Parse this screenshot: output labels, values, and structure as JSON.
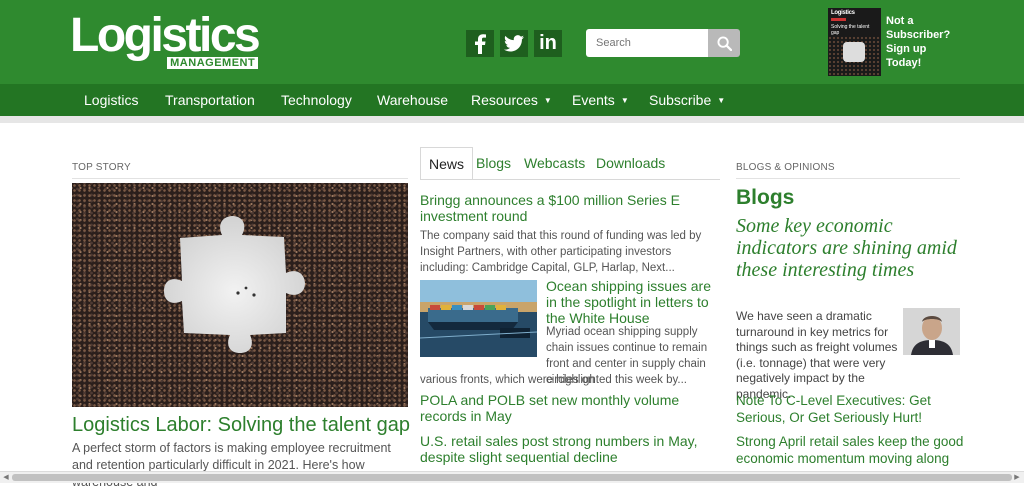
{
  "header": {
    "logo_main": "Logistics",
    "logo_sub": "MANAGEMENT",
    "social": [
      {
        "icon": "facebook-icon",
        "label": "f"
      },
      {
        "icon": "twitter-icon",
        "label": ""
      },
      {
        "icon": "linkedin-icon",
        "label": "in"
      }
    ],
    "search_placeholder": "Search",
    "magazine": {
      "title": "Logistics",
      "headline": "Solving the talent gap"
    },
    "subscribe_cta": [
      "Not a",
      "Subscriber?",
      "Sign up",
      "Today!"
    ]
  },
  "nav": {
    "items": [
      {
        "label": "Logistics"
      },
      {
        "label": "Transportation"
      },
      {
        "label": "Technology"
      },
      {
        "label": "Warehouse"
      },
      {
        "label": "Resources"
      },
      {
        "label": "Events"
      },
      {
        "label": "Subscribe"
      }
    ]
  },
  "top_story": {
    "section_label": "TOP STORY",
    "headline": "Logistics Labor: Solving the talent gap",
    "summary": "A perfect storm of factors is making employee recruitment and retention particularly difficult in 2021. Here's how warehouse and"
  },
  "news": {
    "tabs": [
      "News",
      "Blogs",
      "Webcasts",
      "Downloads"
    ],
    "active_tab": "News",
    "items": [
      {
        "title": "Bringg announces a $100 million Series E investment round",
        "text": "The company said that this round of funding was led by Insight Partners, with other participating investors including: Cambridge Capital, GLP, Harlap, Next..."
      },
      {
        "title": "Ocean shipping issues are in the spotlight in letters to the White House",
        "text_side": "Myriad ocean shipping supply chain issues continue to remain front and center in supply chain circles on",
        "text_full": "various fronts, which were highlighted this week by..."
      },
      {
        "title": "POLA and POLB set new monthly volume records in May"
      },
      {
        "title": "U.S. retail sales post strong numbers in May, despite slight sequential decline"
      }
    ]
  },
  "blogs": {
    "section_label": "BLOGS & OPINIONS",
    "heading": "Blogs",
    "feature_title": "Some key economic indicators are shining amid these interesting times",
    "feature_body": "We have seen a dramatic turnaround in key metrics for things such as freight volumes (i.e. tonnage) that were very negatively impact by the pandemic.",
    "links": [
      "Note To C-Level Executives: Get Serious, Or Get Seriously Hurt!",
      "Strong April retail sales keep the good economic momentum moving along"
    ]
  },
  "colors": {
    "brand_green": "#2f8a2f",
    "nav_green": "#237523",
    "link_green": "#2d7f2d"
  }
}
